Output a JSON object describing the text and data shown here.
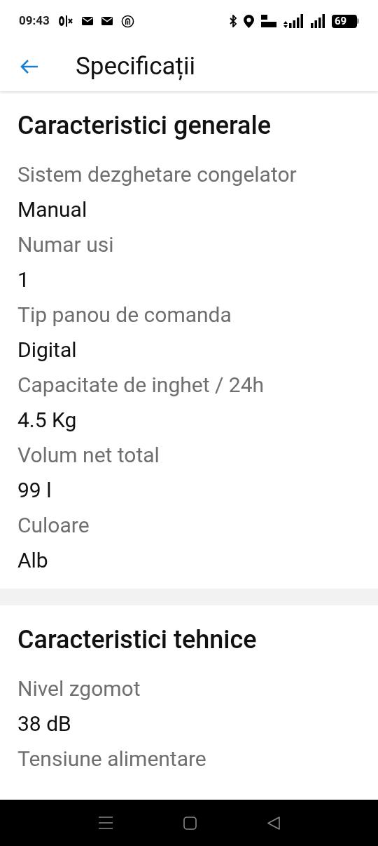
{
  "status_bar": {
    "time": "09:43",
    "battery": "69"
  },
  "header": {
    "title": "Specificații"
  },
  "sections": [
    {
      "title": "Caracteristici generale",
      "specs": [
        {
          "label": "Sistem dezghetare congelator",
          "value": "Manual"
        },
        {
          "label": "Numar usi",
          "value": "1"
        },
        {
          "label": "Tip panou de comanda",
          "value": "Digital"
        },
        {
          "label": "Capacitate de inghet / 24h",
          "value": "4.5 Kg"
        },
        {
          "label": "Volum net total",
          "value": "99 l"
        },
        {
          "label": "Culoare",
          "value": "Alb"
        }
      ]
    },
    {
      "title": "Caracteristici tehnice",
      "specs": [
        {
          "label": "Nivel zgomot",
          "value": "38 dB"
        },
        {
          "label": "Tensiune alimentare"
        }
      ]
    }
  ]
}
